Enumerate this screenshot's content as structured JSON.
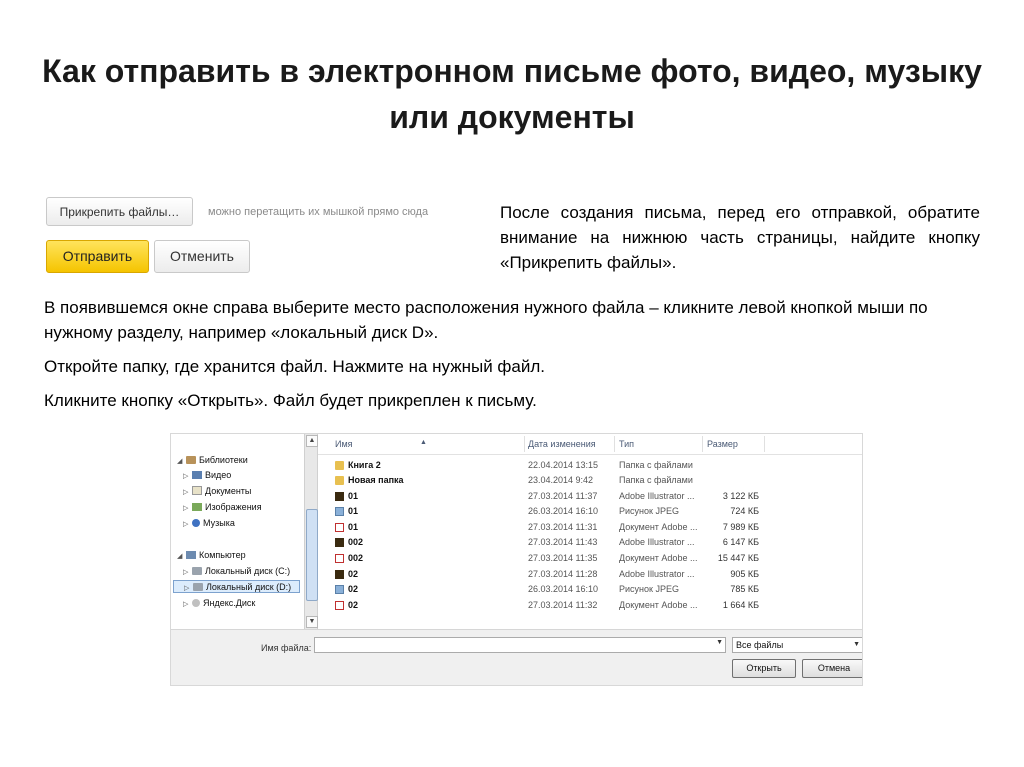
{
  "title": "Как отправить в электронном письме фото, видео, музыку или документы",
  "mail_form": {
    "attach_label": "Прикрепить файлы…",
    "drag_hint": "можно перетащить их мышкой прямо сюда",
    "send_label": "Отправить",
    "cancel_label": "Отменить"
  },
  "text": {
    "right": "После создания письма, перед его отправкой, обратите внимание на нижнюю часть страницы, найдите кнопку «Прикрепить файлы».",
    "p1": "В появившемся окне справа выберите место расположения нужного файла – кликните левой кнопкой мыши по нужному разделу, например «локальный диск D».",
    "p2": "Откройте папку, где хранится файл. Нажмите на нужный файл.",
    "p3": "Кликните кнопку «Открыть». Файл будет прикреплен к письму."
  },
  "dialog": {
    "tree": [
      {
        "label": "Библиотеки",
        "icon": "library-icon",
        "arrow": "◢"
      },
      {
        "label": "Видео",
        "icon": "video-icon",
        "arrow": "▷"
      },
      {
        "label": "Документы",
        "icon": "documents-icon",
        "arrow": "▷"
      },
      {
        "label": "Изображения",
        "icon": "images-icon",
        "arrow": "▷"
      },
      {
        "label": "Музыка",
        "icon": "music-icon",
        "arrow": "▷"
      },
      {
        "label": "Компьютер",
        "icon": "computer-icon",
        "arrow": "◢"
      },
      {
        "label": "Локальный диск (C:)",
        "icon": "disk-icon",
        "arrow": "▷"
      },
      {
        "label": "Локальный диск (D:)",
        "icon": "disk-icon",
        "arrow": "▷"
      },
      {
        "label": "Яндекс.Диск",
        "icon": "yandex-disk-icon",
        "arrow": "▷"
      }
    ],
    "columns": {
      "name": "Имя",
      "date": "Дата изменения",
      "type": "Тип",
      "size": "Размер"
    },
    "files": [
      {
        "name": "Книга 2",
        "date": "22.04.2014 13:15",
        "type": "Папка с файлами",
        "size": "",
        "icon": "folder-icon"
      },
      {
        "name": "Новая папка",
        "date": "23.04.2014 9:42",
        "type": "Папка с файлами",
        "size": "",
        "icon": "folder-icon"
      },
      {
        "name": "01",
        "date": "27.03.2014 11:37",
        "type": "Adobe Illustrator ...",
        "size": "3 122 КБ",
        "icon": "illustrator-icon"
      },
      {
        "name": "01",
        "date": "26.03.2014 16:10",
        "type": "Рисунок JPEG",
        "size": "724 КБ",
        "icon": "jpeg-icon"
      },
      {
        "name": "01",
        "date": "27.03.2014 11:31",
        "type": "Документ Adobe ...",
        "size": "7 989 КБ",
        "icon": "pdf-icon"
      },
      {
        "name": "002",
        "date": "27.03.2014 11:43",
        "type": "Adobe Illustrator ...",
        "size": "6 147 КБ",
        "icon": "illustrator-icon"
      },
      {
        "name": "002",
        "date": "27.03.2014 11:35",
        "type": "Документ Adobe ...",
        "size": "15 447 КБ",
        "icon": "pdf-icon"
      },
      {
        "name": "02",
        "date": "27.03.2014 11:28",
        "type": "Adobe Illustrator ...",
        "size": "905 КБ",
        "icon": "illustrator-icon"
      },
      {
        "name": "02",
        "date": "26.03.2014 16:10",
        "type": "Рисунок JPEG",
        "size": "785 КБ",
        "icon": "jpeg-icon"
      },
      {
        "name": "02",
        "date": "27.03.2014 11:32",
        "type": "Документ Adobe ...",
        "size": "1 664 КБ",
        "icon": "pdf-icon"
      }
    ],
    "filename_label": "Имя файла:",
    "filename_value": "",
    "filter_value": "Все файлы",
    "open_label": "Открыть",
    "cancel_label": "Отмена"
  },
  "colors": {
    "send_button": "#f5c400",
    "selection": "#dcecfc"
  }
}
